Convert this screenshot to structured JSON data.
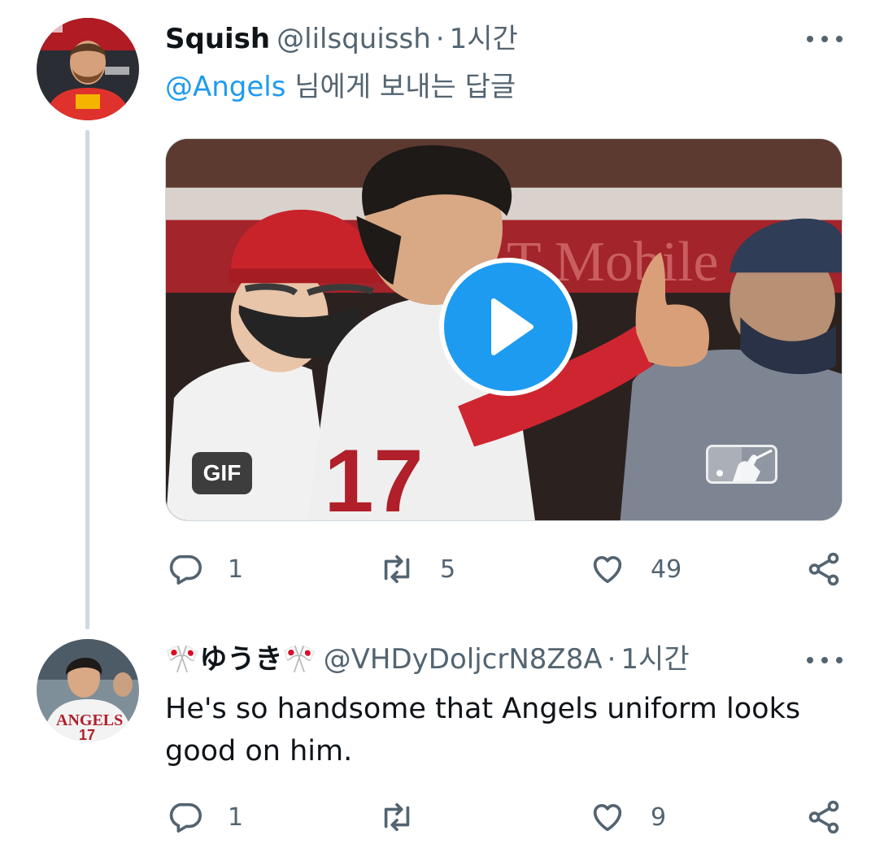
{
  "tweets": [
    {
      "name": "Squish",
      "handle": "@lilsquissh",
      "separator": "·",
      "time": "1시간",
      "reply_mention": "@Angels",
      "reply_suffix": " 님에게 보내는 답글",
      "media": {
        "badge": "GIF",
        "logo": "MLB"
      },
      "actions": {
        "replies": "1",
        "retweets": "5",
        "likes": "49"
      },
      "icons": [
        "reply-icon",
        "retweet-icon",
        "like-icon",
        "share-icon",
        "more-icon",
        "play-icon"
      ]
    },
    {
      "name": "🎌ゆうき🎌",
      "handle": "@VHDyDoljcrN8Z8A",
      "separator": "·",
      "time": "1시간",
      "text": "He's so handsome that Angels uniform looks good on him.",
      "actions": {
        "replies": "1",
        "retweets": "",
        "likes": "9"
      },
      "icons": [
        "reply-icon",
        "retweet-icon",
        "like-icon",
        "share-icon",
        "more-icon"
      ]
    }
  ],
  "colors": {
    "accent": "#1d9bf0",
    "muted": "#536471",
    "text": "#0f1419",
    "thread_line": "#cfd9de"
  }
}
